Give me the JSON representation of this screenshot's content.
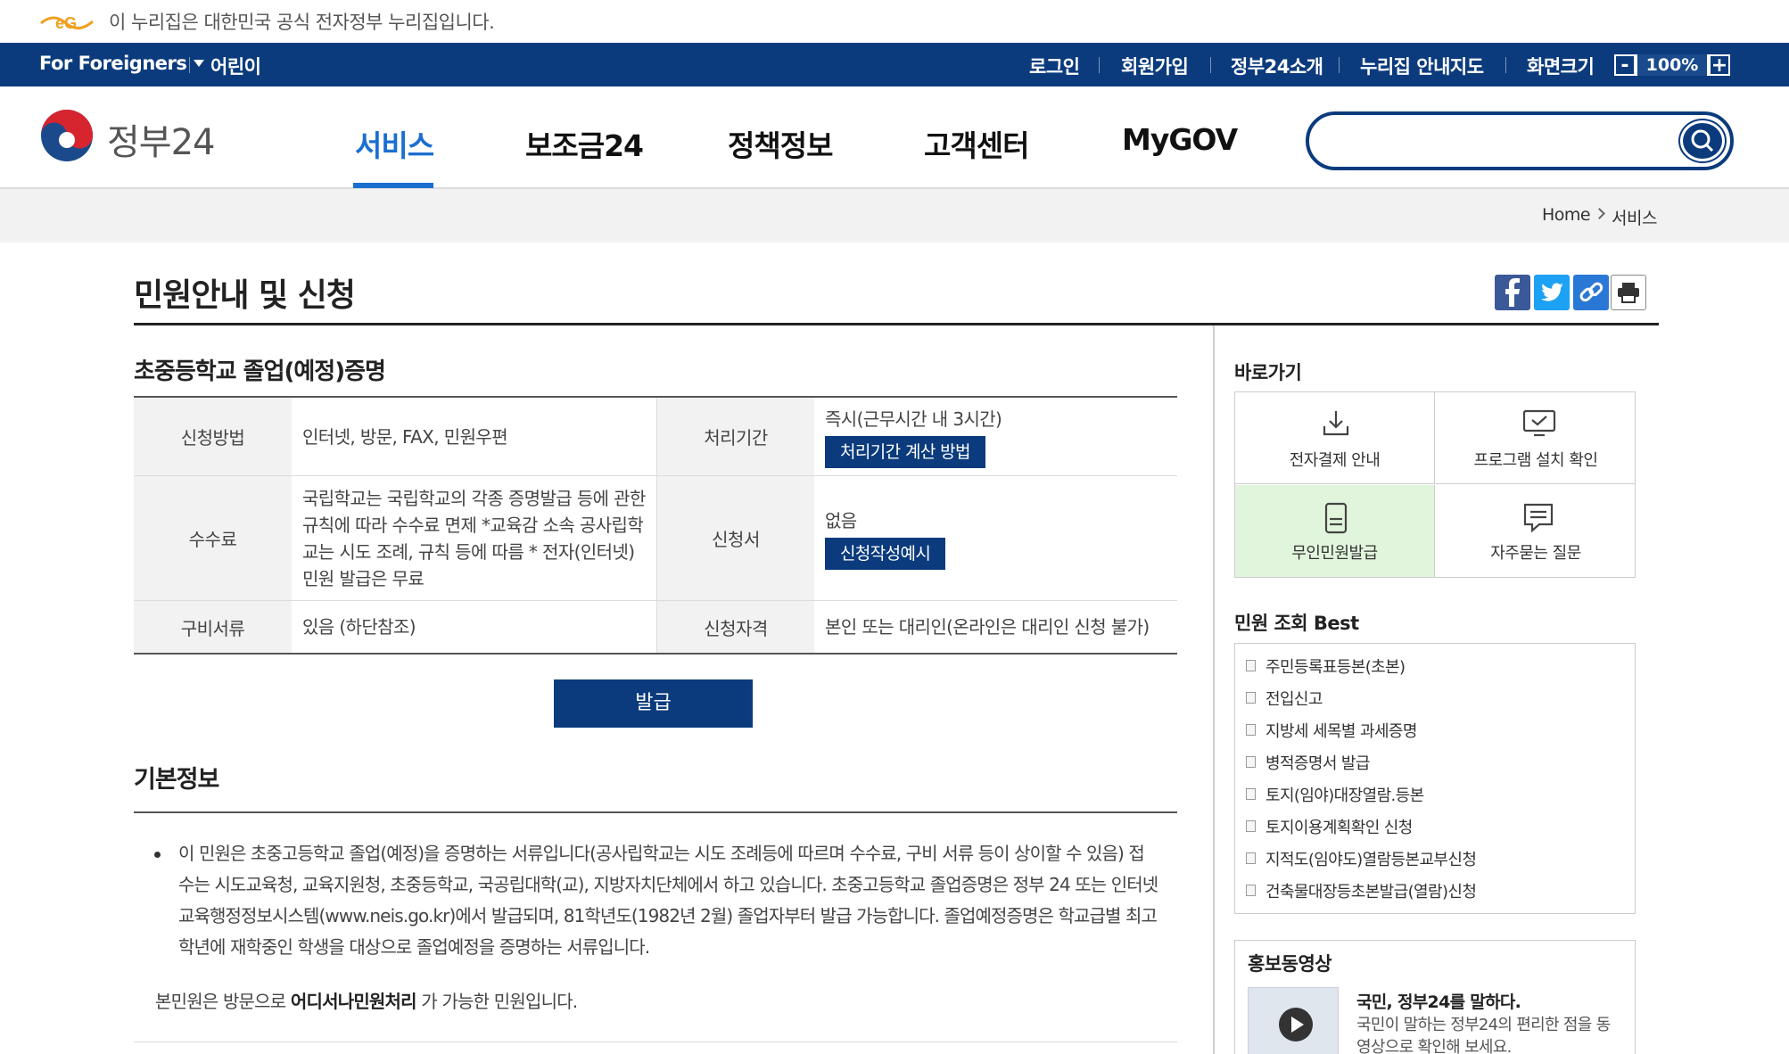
{
  "gov_banner": {
    "text": "이 누리집은 대한민국 공식 전자정부 누리집입니다."
  },
  "util": {
    "foreigners": "For Foreigners",
    "kids": "어린이",
    "login": "로그인",
    "join": "회원가입",
    "about": "정부24소개",
    "sitemap": "누리집 안내지도",
    "screen_size": "화면크기",
    "zoom": "100%",
    "zoom_minus": "-",
    "zoom_plus": "+"
  },
  "header": {
    "logo_text": "정부24",
    "nav": [
      "서비스",
      "보조금24",
      "정책정보",
      "고객센터",
      "MyGOV"
    ],
    "search_placeholder": ""
  },
  "breadcrumb": [
    "Home",
    "서비스"
  ],
  "page_title": "민원안내 및 신청",
  "service": {
    "title": "초중등학교 졸업(예정)증명",
    "rows": [
      {
        "h1": "신청방법",
        "v1": "인터넷, 방문, FAX, 민원우편",
        "h2": "처리기간",
        "v2": "즉시(근무시간 내 3시간)",
        "btn2": "처리기간 계산 방법"
      },
      {
        "h1": "수수료",
        "v1": "국립학교는 국립학교의 각종 증명발급 등에 관한 규칙에 따라 수수료 면제 *교육감 소속 공사립학교는 시도 조례, 규칙 등에 따름 * 전자(인터넷)민원 발급은 무료",
        "h2": "신청서",
        "v2": "없음",
        "btn2": "신청작성예시"
      },
      {
        "h1": "구비서류",
        "v1": "있음 (하단참조)",
        "h2": "신청자격",
        "v2": "본인 또는 대리인(온라인은 대리인 신청 불가)"
      }
    ],
    "issue_button": "발급"
  },
  "basic": {
    "title": "기본정보",
    "body": "이 민원은 초중고등학교 졸업(예정)을 증명하는 서류입니다(공사립학교는 시도 조례등에 따르며 수수료, 구비 서류 등이 상이할 수 있음) 접수는 시도교육청, 교육지원청, 초중등학교, 국공립대학(교), 지방자치단체에서 하고 있습니다. 초중고등학교 졸업증명은 정부 24 또는 인터넷 교육행정정보시스템(www.neis.go.kr)에서 발급되며, 81학년도(1982년 2월) 졸업자부터 발급 가능합니다. 졸업예정증명은 학교급별 최고 학년에 재학중인 학생을 대상으로 졸업예정을 증명하는 서류입니다.",
    "note_prefix": "본민원은 방문으로 ",
    "note_bold": "어디서나민원처리",
    "note_suffix": " 가 가능한 민원입니다."
  },
  "sidebar": {
    "quick_title": "바로가기",
    "quick": [
      {
        "label": "전자결제 안내",
        "icon": "download-icon"
      },
      {
        "label": "프로그램 설치 확인",
        "icon": "monitor-check-icon"
      },
      {
        "label": "무인민원발급",
        "icon": "kiosk-icon"
      },
      {
        "label": "자주묻는 질문",
        "icon": "chat-icon"
      }
    ],
    "best_title": "민원 조회 Best",
    "best": [
      "주민등록표등본(초본)",
      "전입신고",
      "지방세 세목별 과세증명",
      "병적증명서 발급",
      "토지(임야)대장열람.등본",
      "토지이용계획확인 신청",
      "지적도(임야도)열람등본교부신청",
      "건축물대장등초본발급(열람)신청"
    ],
    "promo_title": "홍보동영상",
    "promo_video_title": "국민, 정부24를 말하다.",
    "promo_video_desc": "국민이 말하는 정부24의 편리한 점을 동영상으로 확인해 보세요."
  },
  "colors": {
    "navy": "#0b3b7d",
    "active_blue": "#1a6fd1",
    "kiosk_green": "#e1f5dc"
  }
}
